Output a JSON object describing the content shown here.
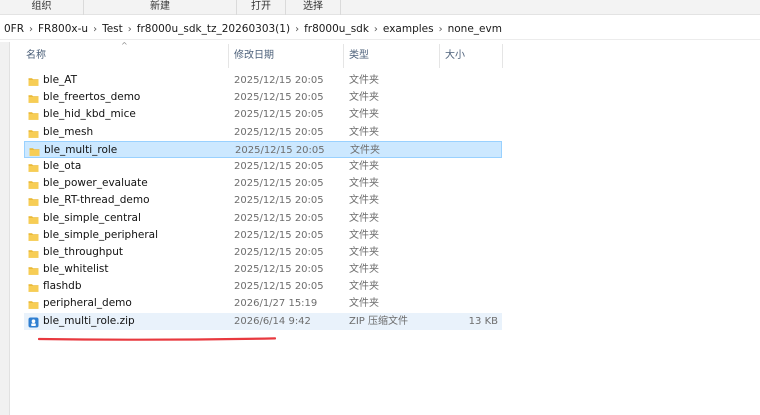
{
  "ribbon": {
    "groups": [
      "组织",
      "新建",
      "打开",
      "选择"
    ]
  },
  "address": {
    "crumbs": [
      "0FR",
      "FR800x-u",
      "Test",
      "fr8000u_sdk_tz_20260303(1)",
      "fr8000u_sdk",
      "examples",
      "none_evm"
    ]
  },
  "columns": {
    "name": "名称",
    "date": "修改日期",
    "type": "类型",
    "size": "大小"
  },
  "files": [
    {
      "name": "ble_AT",
      "date": "2025/12/15 20:05",
      "type": "文件夹",
      "size": "",
      "icon": "folder-icon"
    },
    {
      "name": "ble_freertos_demo",
      "date": "2025/12/15 20:05",
      "type": "文件夹",
      "size": "",
      "icon": "folder-icon"
    },
    {
      "name": "ble_hid_kbd_mice",
      "date": "2025/12/15 20:05",
      "type": "文件夹",
      "size": "",
      "icon": "folder-icon"
    },
    {
      "name": "ble_mesh",
      "date": "2025/12/15 20:05",
      "type": "文件夹",
      "size": "",
      "icon": "folder-icon"
    },
    {
      "name": "ble_multi_role",
      "date": "2025/12/15 20:05",
      "type": "文件夹",
      "size": "",
      "icon": "folder-icon",
      "selected": true
    },
    {
      "name": "ble_ota",
      "date": "2025/12/15 20:05",
      "type": "文件夹",
      "size": "",
      "icon": "folder-icon"
    },
    {
      "name": "ble_power_evaluate",
      "date": "2025/12/15 20:05",
      "type": "文件夹",
      "size": "",
      "icon": "folder-icon"
    },
    {
      "name": "ble_RT-thread_demo",
      "date": "2025/12/15 20:05",
      "type": "文件夹",
      "size": "",
      "icon": "folder-icon"
    },
    {
      "name": "ble_simple_central",
      "date": "2025/12/15 20:05",
      "type": "文件夹",
      "size": "",
      "icon": "folder-icon"
    },
    {
      "name": "ble_simple_peripheral",
      "date": "2025/12/15 20:05",
      "type": "文件夹",
      "size": "",
      "icon": "folder-icon"
    },
    {
      "name": "ble_throughput",
      "date": "2025/12/15 20:05",
      "type": "文件夹",
      "size": "",
      "icon": "folder-icon"
    },
    {
      "name": "ble_whitelist",
      "date": "2025/12/15 20:05",
      "type": "文件夹",
      "size": "",
      "icon": "folder-icon"
    },
    {
      "name": "flashdb",
      "date": "2025/12/15 20:05",
      "type": "文件夹",
      "size": "",
      "icon": "folder-icon"
    },
    {
      "name": "peripheral_demo",
      "date": "2026/1/27 15:19",
      "type": "文件夹",
      "size": "",
      "icon": "folder-icon"
    },
    {
      "name": "ble_multi_role.zip",
      "date": "2026/6/14 9:42",
      "type": "ZIP 压缩文件",
      "size": "13 KB",
      "icon": "zip-archive-icon",
      "hover": true
    }
  ],
  "colors": {
    "selected_bg": "#cce8ff",
    "hover_bg": "#e9f2fb",
    "folder": "#f5c242",
    "annotation": "#e8393f"
  }
}
